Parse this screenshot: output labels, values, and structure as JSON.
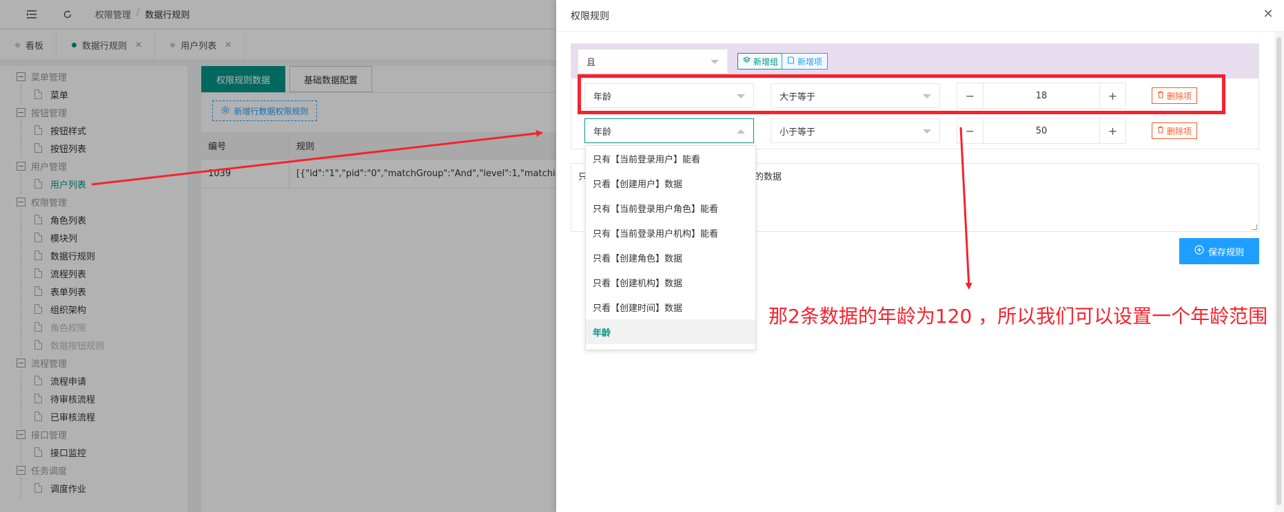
{
  "topbar": {
    "breadcrumb": [
      "权限管理",
      "数据行规则"
    ]
  },
  "tabs": [
    {
      "label": "看板",
      "closable": false
    },
    {
      "label": "数据行规则",
      "closable": true,
      "active": true
    },
    {
      "label": "用户列表",
      "closable": true
    }
  ],
  "sidebar": {
    "items": [
      {
        "type": "group",
        "label": "菜单管理"
      },
      {
        "type": "leaf",
        "label": "菜单"
      },
      {
        "type": "group",
        "label": "按钮管理"
      },
      {
        "type": "leaf",
        "label": "按钮样式"
      },
      {
        "type": "leaf",
        "label": "按钮列表"
      },
      {
        "type": "group",
        "label": "用户管理"
      },
      {
        "type": "leaf",
        "label": "用户列表",
        "active": true
      },
      {
        "type": "group",
        "label": "权限管理"
      },
      {
        "type": "leaf",
        "label": "角色列表"
      },
      {
        "type": "leaf",
        "label": "模块列"
      },
      {
        "type": "leaf",
        "label": "数据行规则"
      },
      {
        "type": "leaf",
        "label": "流程列表"
      },
      {
        "type": "leaf",
        "label": "表单列表"
      },
      {
        "type": "leaf",
        "label": "组织架构"
      },
      {
        "type": "leaf",
        "label": "角色权限",
        "disabled": true
      },
      {
        "type": "leaf",
        "label": "数据按钮规则",
        "disabled": true
      },
      {
        "type": "group",
        "label": "流程管理"
      },
      {
        "type": "leaf",
        "label": "流程申请"
      },
      {
        "type": "leaf",
        "label": "待审核流程"
      },
      {
        "type": "leaf",
        "label": "已审核流程"
      },
      {
        "type": "group",
        "label": "接口管理"
      },
      {
        "type": "leaf",
        "label": "接口监控"
      },
      {
        "type": "group",
        "label": "任务调度"
      },
      {
        "type": "leaf",
        "label": "调度作业"
      }
    ]
  },
  "content": {
    "tab_rules": "权限规则数据",
    "tab_base": "基础数据配置",
    "add_rule_label": "新增行数据权限规则",
    "table": {
      "headers": [
        "编号",
        "规则"
      ],
      "rows": [
        [
          "1039",
          "[{\"id\":\"1\",\"pid\":\"0\",\"matchGroup\":\"And\",\"level\":1,\"matchingWh"
        ]
      ]
    }
  },
  "drawer": {
    "title": "权限规则",
    "group_logic": "且",
    "add_group_label": "新增组",
    "add_item_label": "新增项",
    "conditions": [
      {
        "field": "年龄",
        "operator": "大于等于",
        "value": "18",
        "delete_label": "删除项"
      },
      {
        "field": "年龄",
        "operator": "小于等于",
        "value": "50",
        "delete_label": "删除项"
      }
    ],
    "description_left": "只",
    "description_right": "户的数据",
    "save_label": "保存规则",
    "dropdown_options": [
      "只有【当前登录用户】能看",
      "只看【创建用户】数据",
      "只有【当前登录用户角色】能看",
      "只有【当前登录用户机构】能看",
      "只看【创建角色】数据",
      "只看【创建机构】数据",
      "只看【创建时间】数据",
      "年龄"
    ],
    "dropdown_selected_index": 7
  },
  "annotation": {
    "text": "那2条数据的年龄为120 ，所以我们可以设置一个年龄范围",
    "color": "#f5222d"
  },
  "colors": {
    "primary": "#009688",
    "blue": "#1e9fff",
    "danger": "#ff5722",
    "group_header": "#e8dcef"
  }
}
